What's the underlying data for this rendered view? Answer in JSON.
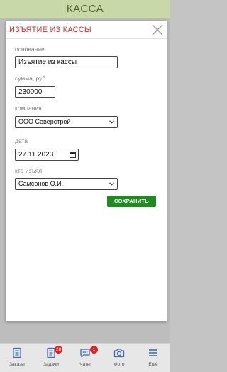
{
  "app": {
    "title": "КАССА"
  },
  "modal": {
    "title": "ИЗЪЯТИЕ ИЗ КАССЫ",
    "fields": {
      "basis": {
        "label": "основание",
        "value": "Изъятие из кассы"
      },
      "amount": {
        "label": "сумма, руб",
        "value": "230000"
      },
      "company": {
        "label": "компания",
        "value": "ООО Северстрой"
      },
      "date": {
        "label": "дата",
        "value": "27.11.2023"
      },
      "withdrawn_by": {
        "label": "кто изъял",
        "value": "Самсонов О.И."
      }
    },
    "save_label": "СОХРАНИТЬ"
  },
  "bottom_nav": {
    "items": [
      {
        "label": "Заказы",
        "icon": "document-icon"
      },
      {
        "label": "Задачи",
        "icon": "tasks-icon",
        "badge": "28"
      },
      {
        "label": "Чаты",
        "icon": "chat-icon",
        "badge": "1"
      },
      {
        "label": "Фото",
        "icon": "camera-icon"
      },
      {
        "label": "Ещё",
        "icon": "menu-icon"
      }
    ]
  },
  "colors": {
    "header_bg": "#c9d8a8",
    "title_red": "#d23030",
    "save_green": "#1f8a1f",
    "nav_blue": "#3d6fb6",
    "badge_red": "#e02020"
  }
}
